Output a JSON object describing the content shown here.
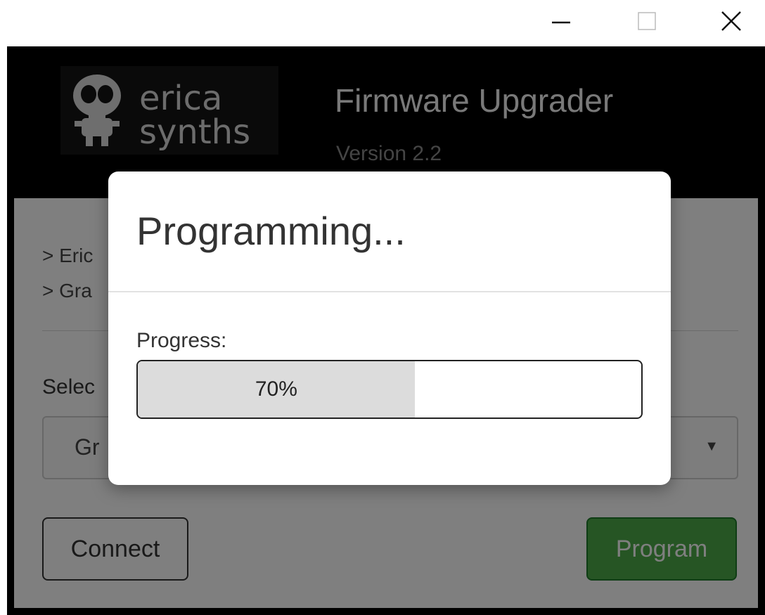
{
  "window": {
    "minimize_icon": "minimize-icon",
    "maximize_icon": "maximize-icon",
    "close_icon": "close-icon"
  },
  "header": {
    "logo_text": "erica synths",
    "title": "Firmware Upgrader",
    "version": "Version 2.2"
  },
  "main": {
    "log_lines": [
      "> Eric",
      "> Gra"
    ],
    "select_label": "Selec",
    "selected_value": "Gr",
    "connect_label": "Connect",
    "program_label": "Program"
  },
  "modal": {
    "title": "Programming...",
    "progress_label": "Progress:",
    "progress_text": "70%",
    "progress_fill_fraction": 0.55
  },
  "colors": {
    "header_bg": "#000000",
    "program_button": "#4caa48",
    "progress_fill": "#dcdcdc"
  }
}
